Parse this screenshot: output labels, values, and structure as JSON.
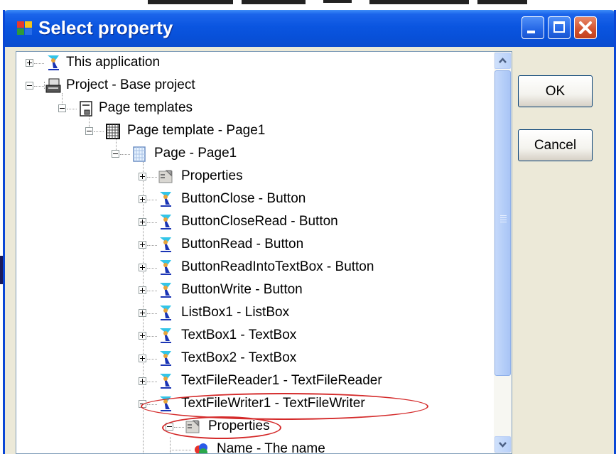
{
  "window": {
    "title": "Select property"
  },
  "buttons": {
    "ok": "OK",
    "cancel": "Cancel"
  },
  "tree": {
    "items": [
      {
        "label": "This application"
      },
      {
        "label": "Project - Base project"
      },
      {
        "label": "Page templates"
      },
      {
        "label": "Page template - Page1"
      },
      {
        "label": "Page - Page1"
      },
      {
        "label": "Properties"
      },
      {
        "label": "ButtonClose - Button"
      },
      {
        "label": "ButtonCloseRead - Button"
      },
      {
        "label": "ButtonRead - Button"
      },
      {
        "label": "ButtonReadIntoTextBox - Button"
      },
      {
        "label": "ButtonWrite - Button"
      },
      {
        "label": "ListBox1 - ListBox"
      },
      {
        "label": "TextBox1 - TextBox"
      },
      {
        "label": "TextBox2 - TextBox"
      },
      {
        "label": "TextFileReader1 - TextFileReader"
      },
      {
        "label": "TextFileWriter1 - TextFileWriter"
      },
      {
        "label": "Properties"
      },
      {
        "label": "Name - The name"
      }
    ]
  },
  "annotations": {
    "color": "#d42a2a"
  }
}
